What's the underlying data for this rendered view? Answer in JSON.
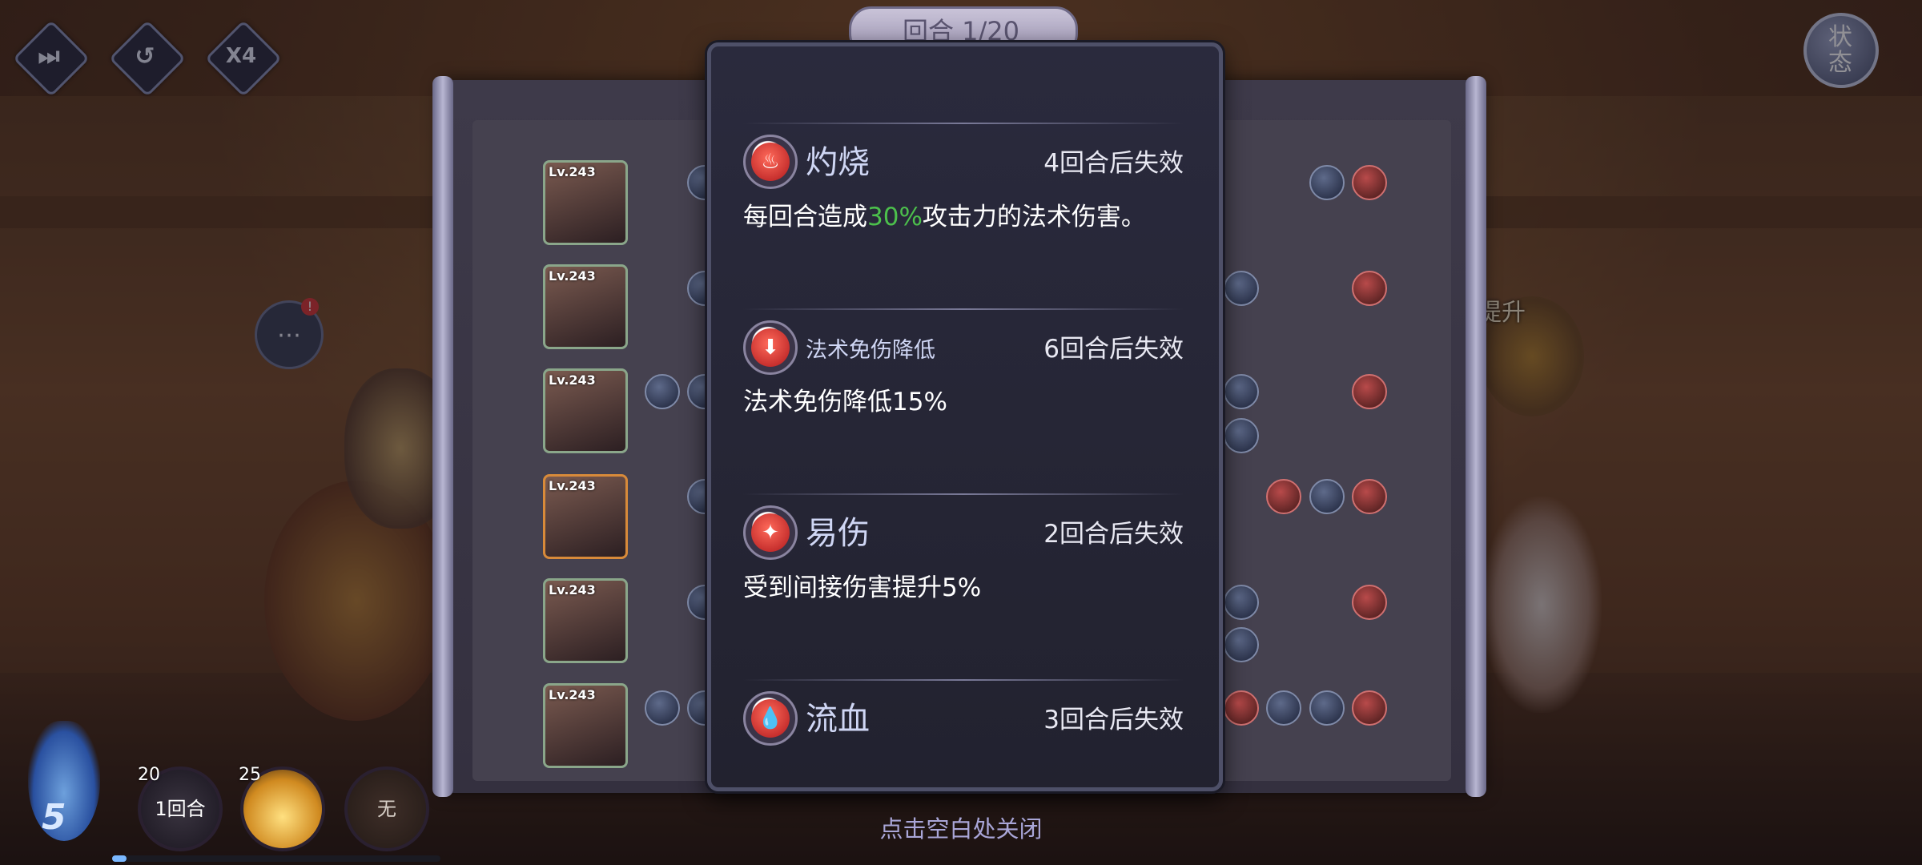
{
  "controls": {
    "skip_glyph": "⏭",
    "replay_glyph": "↺",
    "speed_label": "X4"
  },
  "status_button": {
    "label": "状\n态"
  },
  "round": {
    "label": "回合 1/20"
  },
  "heroes": [
    {
      "level": "Lv.243"
    },
    {
      "level": "Lv.243"
    },
    {
      "level": "Lv.243"
    },
    {
      "level": "Lv.243"
    },
    {
      "level": "Lv.243"
    },
    {
      "level": "Lv.243"
    }
  ],
  "right_side_label": "提升",
  "buff_popup": {
    "items": [
      {
        "icon": "burn-icon",
        "name": "灼烧",
        "duration": "4回合后失效",
        "desc_prefix": "每回合造成",
        "desc_highlight": "30%",
        "desc_suffix": "攻击力的法术伤害。"
      },
      {
        "icon": "magic-defense-down-icon",
        "name": "法术免伤降低",
        "duration": "6回合后失效",
        "desc_prefix": "法术免伤降低15%",
        "desc_highlight": "",
        "desc_suffix": ""
      },
      {
        "icon": "vulnerable-icon",
        "name": "易伤",
        "duration": "2回合后失效",
        "desc_prefix": "受到间接伤害提升5%",
        "desc_highlight": "",
        "desc_suffix": ""
      },
      {
        "icon": "bleed-icon",
        "name": "流血",
        "duration": "3回合后失效",
        "desc_prefix": "",
        "desc_highlight": "",
        "desc_suffix": ""
      }
    ],
    "close_hint": "点击空白处关闭"
  },
  "bottom_bar": {
    "fire_count": "5",
    "skills": [
      {
        "cost": "20",
        "label": "1回合"
      },
      {
        "cost": "25",
        "label": ""
      },
      {
        "cost": "",
        "label": "无"
      }
    ]
  },
  "colors": {
    "highlight_green": "#4cc04c",
    "popup_bg": "#22222f",
    "accent_red": "#d0303a"
  }
}
